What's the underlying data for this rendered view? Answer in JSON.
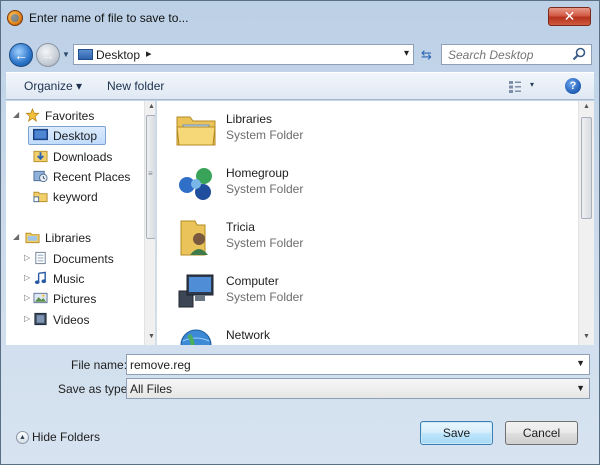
{
  "window": {
    "title": "Enter name of file to save to...",
    "close_label": "✕"
  },
  "address": {
    "location": "Desktop",
    "chevron": "▸",
    "dropdown": "▾"
  },
  "search": {
    "placeholder": "Search Desktop"
  },
  "toolbar": {
    "organize_label": "Organize ▾",
    "new_folder_label": "New folder",
    "views_dropdown": "▾",
    "help_label": "?"
  },
  "sidebar": {
    "favorites": {
      "label": "Favorites",
      "items": [
        {
          "label": "Desktop",
          "icon": "desktop-icon",
          "selected": true
        },
        {
          "label": "Downloads",
          "icon": "downloads-icon"
        },
        {
          "label": "Recent Places",
          "icon": "recent-places-icon"
        },
        {
          "label": "keyword",
          "icon": "folder-link-icon"
        }
      ]
    },
    "libraries": {
      "label": "Libraries",
      "items": [
        {
          "label": "Documents",
          "icon": "documents-icon"
        },
        {
          "label": "Music",
          "icon": "music-icon"
        },
        {
          "label": "Pictures",
          "icon": "pictures-icon"
        },
        {
          "label": "Videos",
          "icon": "videos-icon"
        }
      ]
    }
  },
  "files": [
    {
      "name": "Libraries",
      "type": "System Folder",
      "icon": "libraries-folder-icon"
    },
    {
      "name": "Homegroup",
      "type": "System Folder",
      "icon": "homegroup-icon"
    },
    {
      "name": "Tricia",
      "type": "System Folder",
      "icon": "user-folder-icon"
    },
    {
      "name": "Computer",
      "type": "System Folder",
      "icon": "computer-icon"
    },
    {
      "name": "Network",
      "type": "",
      "icon": "network-icon"
    }
  ],
  "form": {
    "file_name_label": "File name:",
    "file_name_value": "remove.reg",
    "save_as_type_label": "Save as type:",
    "save_as_type_value": "All Files"
  },
  "footer": {
    "hide_folders_label": "Hide Folders",
    "save_label": "Save",
    "cancel_label": "Cancel"
  }
}
